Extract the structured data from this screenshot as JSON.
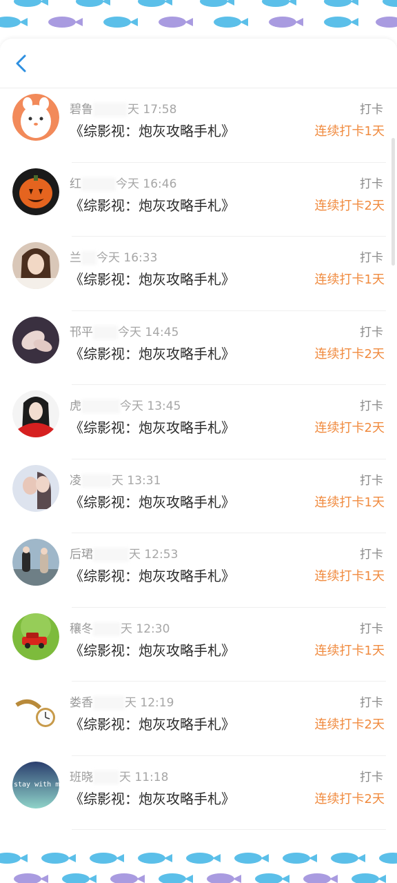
{
  "header": {
    "back_icon": "chevron-left-icon",
    "accent": "#2d8fe0"
  },
  "entries": [
    {
      "name": "碧鲁",
      "time": "天 17:58",
      "action": "打卡",
      "title": "《综影视：炮灰攻略手札》",
      "streak": "连续打卡1天",
      "avatar": "cartoon-face"
    },
    {
      "name": "红",
      "time": "今天 16:46",
      "action": "打卡",
      "title": "《综影视：炮灰攻略手札》",
      "streak": "连续打卡2天",
      "avatar": "pumpkin"
    },
    {
      "name": "兰",
      "time": "今天 16:33",
      "action": "打卡",
      "title": "《综影视：炮灰攻略手札》",
      "streak": "连续打卡1天",
      "avatar": "girl-portrait"
    },
    {
      "name": "邗平",
      "time": "今天 14:45",
      "action": "打卡",
      "title": "《综影视：炮灰攻略手札》",
      "streak": "连续打卡2天",
      "avatar": "hands"
    },
    {
      "name": "虎",
      "time": "今天 13:45",
      "action": "打卡",
      "title": "《综影视：炮灰攻略手札》",
      "streak": "连续打卡2天",
      "avatar": "girl-red"
    },
    {
      "name": "凌",
      "time": "天 13:31",
      "action": "打卡",
      "title": "《综影视：炮灰攻略手札》",
      "streak": "连续打卡1天",
      "avatar": "couple"
    },
    {
      "name": "后珺",
      "time": "天 12:53",
      "action": "打卡",
      "title": "《综影视：炮灰攻略手札》",
      "streak": "连续打卡1天",
      "avatar": "two-girls"
    },
    {
      "name": "穰冬",
      "time": "天 12:30",
      "action": "打卡",
      "title": "《综影视：炮灰攻略手札》",
      "streak": "连续打卡1天",
      "avatar": "red-car"
    },
    {
      "name": "娄香",
      "time": "天 12:19",
      "action": "打卡",
      "title": "《综影视：炮灰攻略手札》",
      "streak": "连续打卡2天",
      "avatar": "pocket-watch"
    },
    {
      "name": "班晓",
      "time": "天 11:18",
      "action": "打卡",
      "title": "《综影视：炮灰攻略手札》",
      "streak": "连续打卡2天",
      "avatar": "stay-with-me"
    }
  ],
  "avatar_text": "stay with m",
  "colors": {
    "streak": "#f08a3e",
    "name": "#9a9a9a",
    "title": "#2b2b2b",
    "fish_blue": "#5bbfe9",
    "fish_purple": "#a99be0"
  }
}
